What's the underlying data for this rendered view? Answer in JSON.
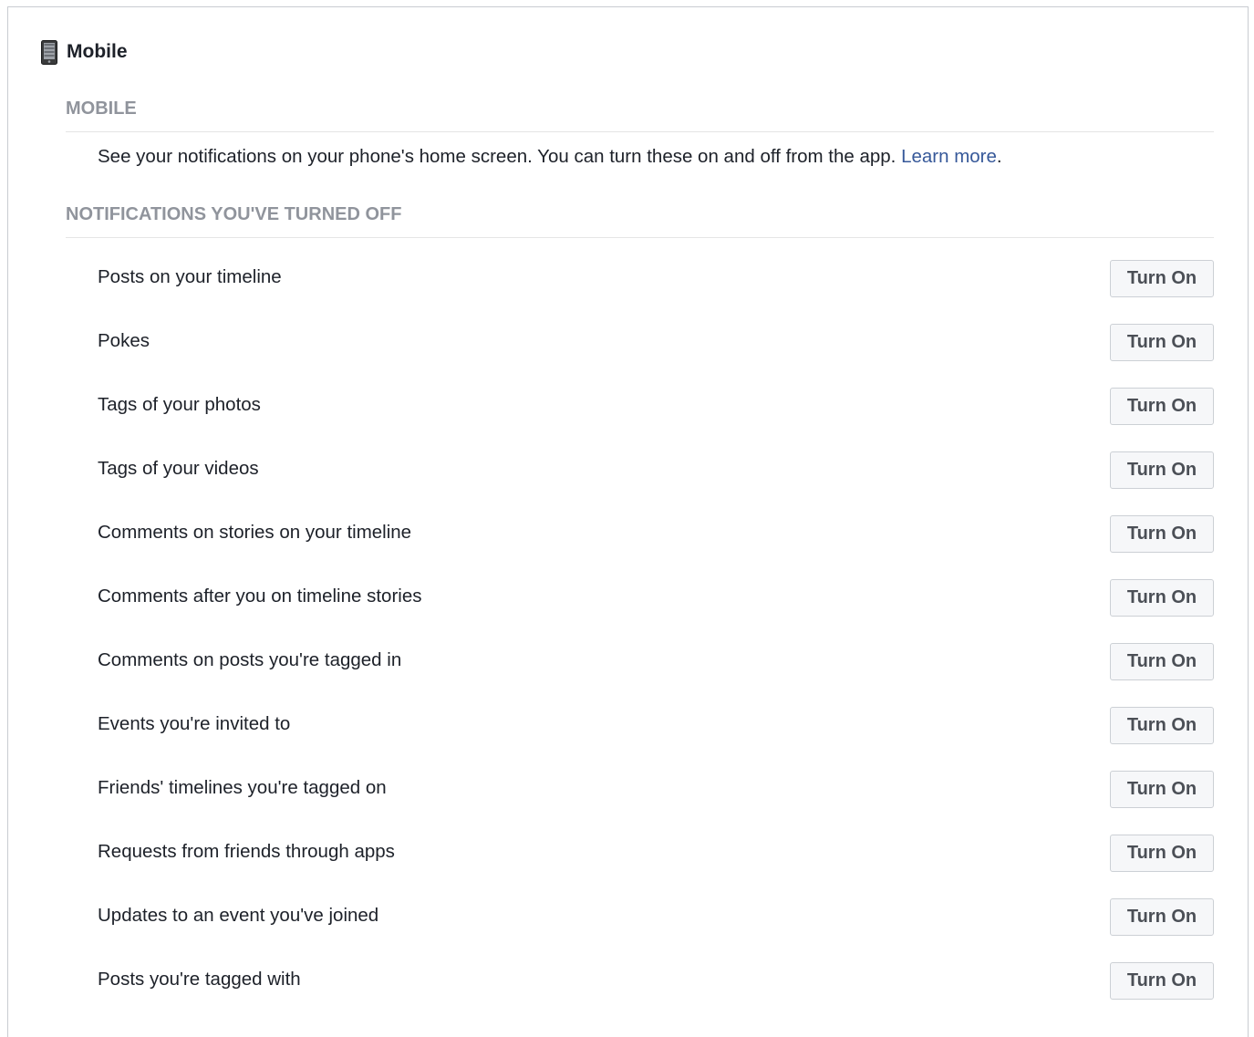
{
  "header": {
    "icon": "mobile-phone-icon",
    "title": "Mobile"
  },
  "mobile_section": {
    "label": "MOBILE",
    "description": "See your notifications on your phone's home screen. You can turn these on and off from the app. ",
    "learn_more": "Learn more",
    "trailing": "."
  },
  "off_section": {
    "label": "NOTIFICATIONS YOU'VE TURNED OFF",
    "items": [
      {
        "label": "Posts on your timeline",
        "button": "Turn On"
      },
      {
        "label": "Pokes",
        "button": "Turn On"
      },
      {
        "label": "Tags of your photos",
        "button": "Turn On"
      },
      {
        "label": "Tags of your videos",
        "button": "Turn On"
      },
      {
        "label": "Comments on stories on your timeline",
        "button": "Turn On"
      },
      {
        "label": "Comments after you on timeline stories",
        "button": "Turn On"
      },
      {
        "label": "Comments on posts you're tagged in",
        "button": "Turn On"
      },
      {
        "label": "Events you're invited to",
        "button": "Turn On"
      },
      {
        "label": "Friends' timelines you're tagged on",
        "button": "Turn On"
      },
      {
        "label": "Requests from friends through apps",
        "button": "Turn On"
      },
      {
        "label": "Updates to an event you've joined",
        "button": "Turn On"
      },
      {
        "label": "Posts you're tagged with",
        "button": "Turn On"
      }
    ]
  },
  "colors": {
    "link": "#365899",
    "section_label": "#90949c",
    "button_bg": "#f6f7f9",
    "button_border": "#ccd0d5"
  }
}
